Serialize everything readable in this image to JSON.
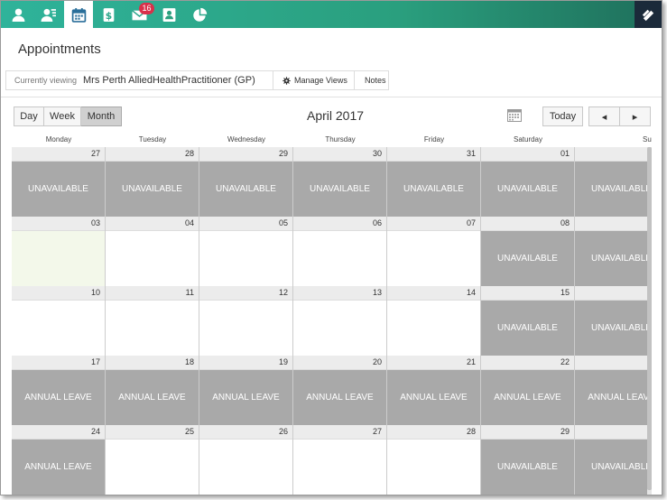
{
  "colors": {
    "nav_start": "#2fb39a",
    "nav_end": "#1f6f5b",
    "badge": "#d9304a",
    "unavailable": "#a9a9a9",
    "today_bg": "#f3f8ea"
  },
  "nav": {
    "items": [
      {
        "icon": "user-icon"
      },
      {
        "icon": "contacts-icon"
      },
      {
        "icon": "calendar-icon",
        "active": true
      },
      {
        "icon": "billing-icon"
      },
      {
        "icon": "mail-icon",
        "badge": "16"
      },
      {
        "icon": "address-book-icon"
      },
      {
        "icon": "reports-pie-icon"
      }
    ],
    "logo_icon": "app-logo-icon"
  },
  "page": {
    "title": "Appointments"
  },
  "viewbar": {
    "label": "Currently viewing",
    "practitioner": "Mrs Perth AlliedHealthPractitioner (GP)",
    "manage_views": "Manage Views",
    "notes": "Notes"
  },
  "toolbar": {
    "day": "Day",
    "week": "Week",
    "month": "Month",
    "active_view": "Month",
    "title": "April 2017",
    "today": "Today",
    "prev": "◂",
    "next": "▸"
  },
  "calendar": {
    "days_of_week": [
      "Monday",
      "Tuesday",
      "Wednesday",
      "Thursday",
      "Friday",
      "Saturday",
      "Su"
    ],
    "weeks": [
      {
        "days": [
          {
            "n": "27",
            "s": "UNAVAILABLE"
          },
          {
            "n": "28",
            "s": "UNAVAILABLE"
          },
          {
            "n": "29",
            "s": "UNAVAILABLE"
          },
          {
            "n": "30",
            "s": "UNAVAILABLE"
          },
          {
            "n": "31",
            "s": "UNAVAILABLE"
          },
          {
            "n": "01",
            "s": "UNAVAILABLE"
          },
          {
            "n": "",
            "s": "UNAVAILABLE"
          }
        ]
      },
      {
        "days": [
          {
            "n": "03",
            "s": "",
            "today": true
          },
          {
            "n": "04",
            "s": ""
          },
          {
            "n": "05",
            "s": ""
          },
          {
            "n": "06",
            "s": ""
          },
          {
            "n": "07",
            "s": ""
          },
          {
            "n": "08",
            "s": "UNAVAILABLE"
          },
          {
            "n": "",
            "s": "UNAVAILABLE"
          }
        ]
      },
      {
        "days": [
          {
            "n": "10",
            "s": ""
          },
          {
            "n": "11",
            "s": ""
          },
          {
            "n": "12",
            "s": ""
          },
          {
            "n": "13",
            "s": ""
          },
          {
            "n": "14",
            "s": ""
          },
          {
            "n": "15",
            "s": "UNAVAILABLE"
          },
          {
            "n": "",
            "s": "UNAVAILABLE"
          }
        ]
      },
      {
        "days": [
          {
            "n": "17",
            "s": "ANNUAL LEAVE"
          },
          {
            "n": "18",
            "s": "ANNUAL LEAVE"
          },
          {
            "n": "19",
            "s": "ANNUAL LEAVE"
          },
          {
            "n": "20",
            "s": "ANNUAL LEAVE"
          },
          {
            "n": "21",
            "s": "ANNUAL LEAVE"
          },
          {
            "n": "22",
            "s": "ANNUAL LEAVE"
          },
          {
            "n": "",
            "s": "ANNUAL LEAVE"
          }
        ]
      },
      {
        "days": [
          {
            "n": "24",
            "s": "ANNUAL LEAVE"
          },
          {
            "n": "25",
            "s": ""
          },
          {
            "n": "26",
            "s": ""
          },
          {
            "n": "27",
            "s": ""
          },
          {
            "n": "28",
            "s": ""
          },
          {
            "n": "29",
            "s": "UNAVAILABLE"
          },
          {
            "n": "",
            "s": "UNAVAILABLE"
          }
        ]
      }
    ]
  }
}
